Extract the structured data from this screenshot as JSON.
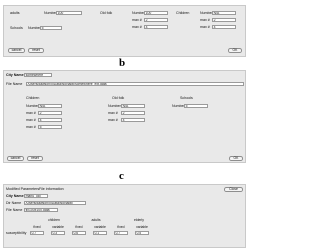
{
  "panels": {
    "a": {
      "letter": "a",
      "groups": [
        {
          "title": "adults",
          "number_label": "Number",
          "number_value": "100"
        },
        {
          "title": "Old folk",
          "number_label": "Number",
          "number_value": "100",
          "max_label": "max #",
          "max_value": "2",
          "max2_label": "max #",
          "max2_value": "4"
        },
        {
          "title": "Children",
          "number_label": "Number",
          "number_value": "N/A",
          "max_label": "max #",
          "max_value": "2",
          "max2_label": "max #",
          "max2_value": "4"
        }
      ],
      "schools_label": "Schools",
      "schools_value": "5",
      "cancel_label": "cancel",
      "reset_label": "reset",
      "ok_label": "OK"
    },
    "b": {
      "letter": "b",
      "city_name_label": "City Name",
      "city_name_value": "somewhere",
      "file_name_label": "File Name",
      "file_name_value": "/Users/dawson/IIIData/NoNaMi/somewhere_ext.data",
      "groups": [
        {
          "title": "Children",
          "number_label": "Number",
          "number_value": "N/A",
          "max_label": "max #",
          "max_value": "2",
          "max2_label": "max #",
          "max2_value": "4",
          "max3_label": "max #",
          "max3_value": "5"
        },
        {
          "title": "Old folk",
          "number_label": "Number",
          "number_value": "N/A",
          "max_label": "max #",
          "max_value": "2",
          "max2_label": "max #",
          "max2_value": "4"
        },
        {
          "title": "Schools",
          "number_label": "Number",
          "number_value": "5"
        }
      ],
      "cancel_label": "cancel",
      "reset_label": "reset",
      "ok_label": "OK"
    },
    "c": {
      "letter": "c",
      "tabs": [
        "Modified Parameters",
        "File information"
      ],
      "close_label": "Close",
      "city_name_label": "City Name",
      "city_name_value": "manu_old",
      "dir_name_label": "Dir Name",
      "dir_name_value": "/Users/dawson/IIIData/NoNaMi/",
      "file_name_label": "File Name",
      "file_name_value": "fix100x100.data",
      "group_headers": [
        "children",
        "adults",
        "elderly"
      ],
      "col_headers": [
        "fixed",
        "variable",
        "fixed",
        "variable",
        "fixed",
        "variable"
      ],
      "row_label": "susceptibility",
      "row_values": [
        "0.7",
        "0.3",
        "0.6",
        "0.1",
        "0.7",
        "0.5"
      ]
    }
  }
}
